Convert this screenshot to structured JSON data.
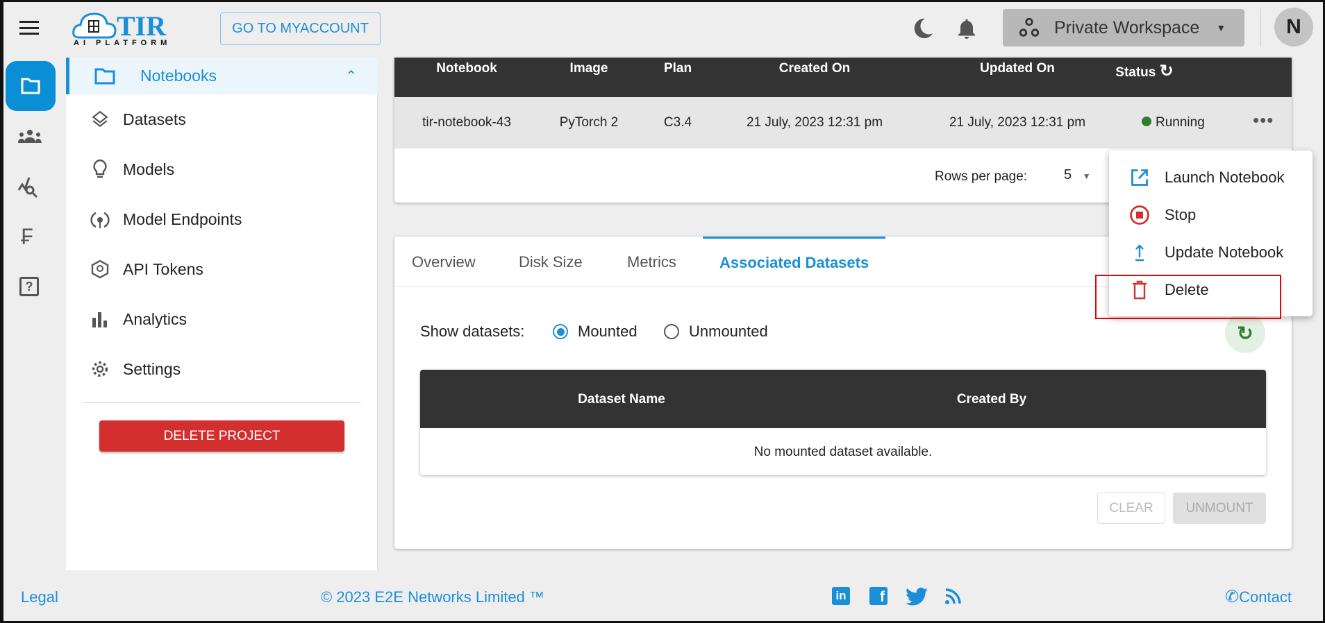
{
  "header": {
    "brand": "TIR",
    "brand_sub": "AI PLATFORM",
    "goto_label": "GO TO MYACCOUNT",
    "workspace": "Private Workspace",
    "avatar_letter": "N"
  },
  "rail": {
    "icons": [
      "folder-icon",
      "team-icon",
      "monitoring-icon",
      "billing-icon",
      "help-icon"
    ]
  },
  "sidebar": {
    "items": [
      {
        "label": "Notebooks",
        "icon": "folder-icon",
        "active": true
      },
      {
        "label": "Datasets",
        "icon": "layers-icon"
      },
      {
        "label": "Models",
        "icon": "lightbulb-icon"
      },
      {
        "label": "Model Endpoints",
        "icon": "endpoint-icon"
      },
      {
        "label": "API Tokens",
        "icon": "token-icon"
      },
      {
        "label": "Analytics",
        "icon": "bar-chart-icon"
      },
      {
        "label": "Settings",
        "icon": "gear-icon"
      }
    ],
    "delete_label": "DELETE PROJECT"
  },
  "notebooks_table": {
    "columns": [
      "Notebook",
      "Image",
      "Plan",
      "Created On",
      "Updated On",
      "Status"
    ],
    "rows": [
      {
        "notebook": "tir-notebook-43",
        "image": "PyTorch 2",
        "plan": "C3.4",
        "created": "21 July, 2023 12:31 pm",
        "updated": "21 July, 2023 12:31 pm",
        "status": "Running"
      }
    ],
    "rows_per_page_label": "Rows per page:",
    "rows_per_page": "5"
  },
  "action_menu": {
    "items": [
      {
        "label": "Launch Notebook",
        "icon": "open-external-icon"
      },
      {
        "label": "Stop",
        "icon": "stop-icon"
      },
      {
        "label": "Update Notebook",
        "icon": "upload-icon"
      },
      {
        "label": "Delete",
        "icon": "trash-icon"
      }
    ]
  },
  "details": {
    "tabs": [
      "Overview",
      "Disk Size",
      "Metrics",
      "Associated Datasets"
    ],
    "active_tab": "Associated Datasets",
    "show_label": "Show datasets:",
    "radio": [
      "Mounted",
      "Unmounted"
    ],
    "selected": "Mounted",
    "columns": [
      "Dataset Name",
      "Created By"
    ],
    "empty": "No mounted dataset available.",
    "clear_label": "CLEAR",
    "unmount_label": "UNMOUNT"
  },
  "footer": {
    "legal": "Legal",
    "copyright": "© 2023 E2E Networks Limited ™",
    "social": [
      "linkedin-icon",
      "facebook-icon",
      "twitter-icon",
      "rss-icon"
    ],
    "contact": "Contact"
  },
  "colors": {
    "accent": "#1a8fd8",
    "danger": "#d32f2f",
    "running": "#2e7d32",
    "table_header": "#333333"
  }
}
